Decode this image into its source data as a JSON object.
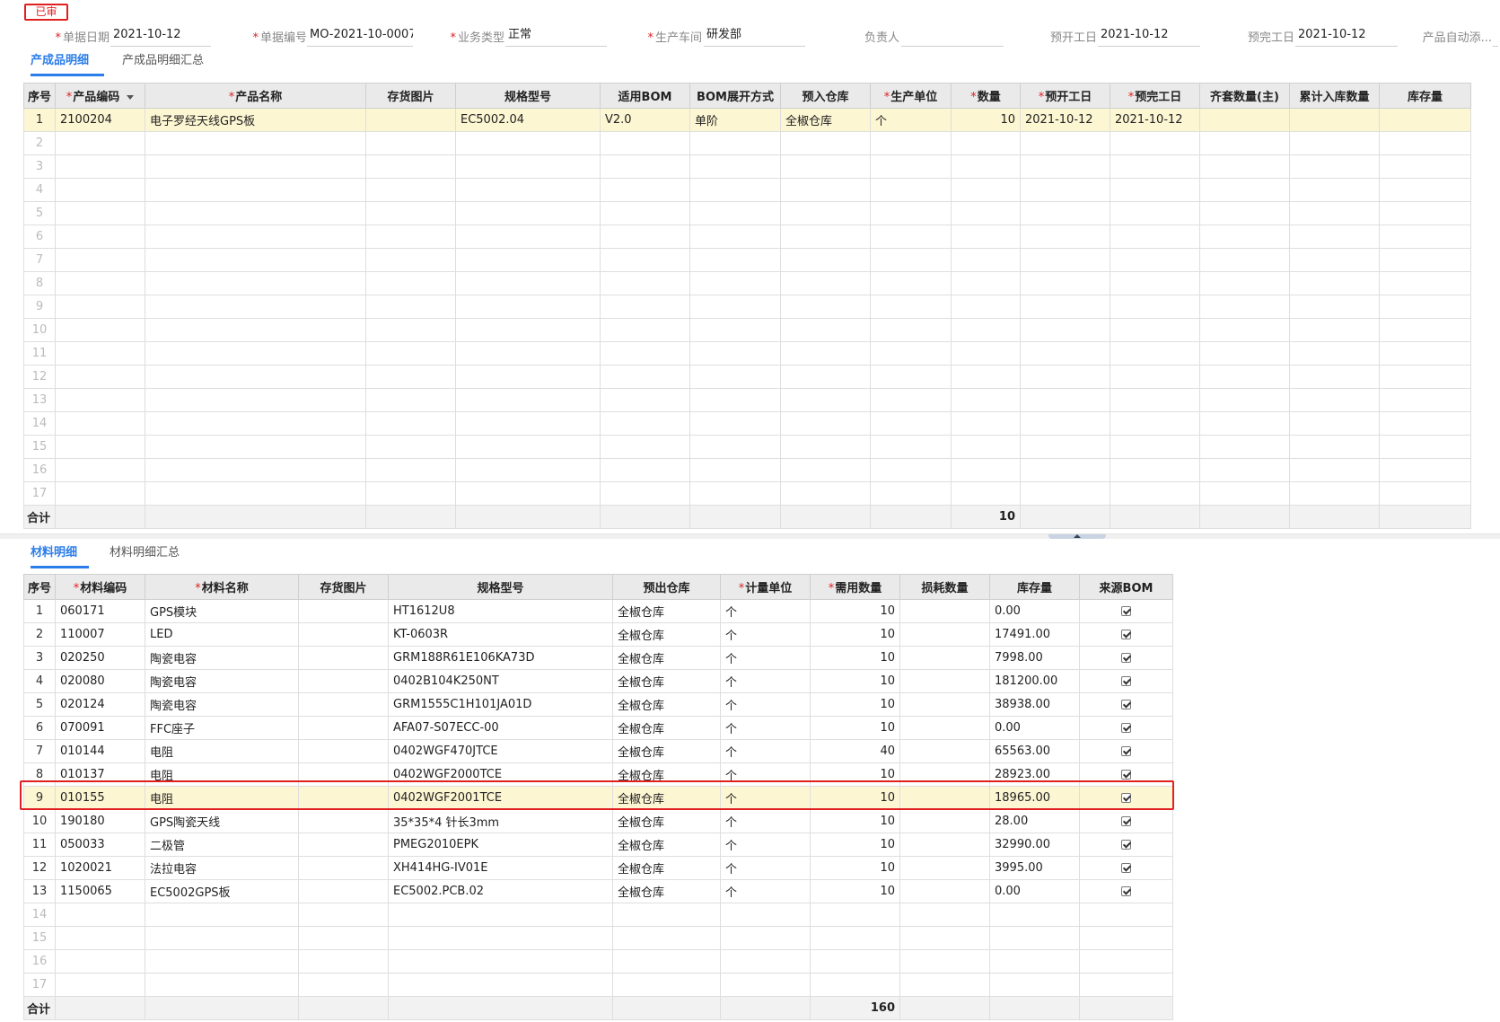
{
  "status_badge": "已审",
  "header": {
    "fields": [
      {
        "label": "单据日期",
        "required": true,
        "value": "2021-10-12"
      },
      {
        "label": "单据编号",
        "required": true,
        "value": "MO-2021-10-0007"
      },
      {
        "label": "业务类型",
        "required": true,
        "value": "正常"
      },
      {
        "label": "生产车间",
        "required": true,
        "value": "研发部"
      },
      {
        "label": "负责人",
        "required": false,
        "value": ""
      },
      {
        "label": "预开工日",
        "required": false,
        "value": "2021-10-12"
      },
      {
        "label": "预完工日",
        "required": false,
        "value": "2021-10-12"
      },
      {
        "label": "产品自动添...",
        "required": false,
        "value": ""
      }
    ]
  },
  "product_tabs": [
    "产成品明细",
    "产成品明细汇总"
  ],
  "product_table": {
    "columns": [
      {
        "label": "序号",
        "required": false
      },
      {
        "label": "产品编码",
        "required": true
      },
      {
        "label": "产品名称",
        "required": true
      },
      {
        "label": "存货图片",
        "required": false
      },
      {
        "label": "规格型号",
        "required": false
      },
      {
        "label": "适用BOM",
        "required": false
      },
      {
        "label": "BOM展开方式",
        "required": false
      },
      {
        "label": "预入仓库",
        "required": false
      },
      {
        "label": "生产单位",
        "required": true
      },
      {
        "label": "数量",
        "required": true
      },
      {
        "label": "预开工日",
        "required": true
      },
      {
        "label": "预完工日",
        "required": true
      },
      {
        "label": "齐套数量(主)",
        "required": false
      },
      {
        "label": "累计入库数量",
        "required": false
      },
      {
        "label": "库存量",
        "required": false
      }
    ],
    "rows": [
      [
        "1",
        "2100204",
        "电子罗经天线GPS板",
        "",
        "EC5002.04",
        "V2.0",
        "单阶",
        "全椒仓库",
        "个",
        "10",
        "2021-10-12",
        "2021-10-12",
        "",
        "",
        ""
      ]
    ],
    "row_count": 17,
    "total_label": "合计",
    "total_qty": "10"
  },
  "material_tabs": [
    "材料明细",
    "材料明细汇总"
  ],
  "material_table": {
    "columns": [
      {
        "label": "序号",
        "required": false
      },
      {
        "label": "材料编码",
        "required": true
      },
      {
        "label": "材料名称",
        "required": true
      },
      {
        "label": "存货图片",
        "required": false
      },
      {
        "label": "规格型号",
        "required": false
      },
      {
        "label": "预出仓库",
        "required": false
      },
      {
        "label": "计量单位",
        "required": true
      },
      {
        "label": "需用数量",
        "required": true
      },
      {
        "label": "损耗数量",
        "required": false
      },
      {
        "label": "库存量",
        "required": false
      },
      {
        "label": "来源BOM",
        "required": false
      }
    ],
    "rows": [
      [
        "1",
        "060171",
        "GPS模块",
        "",
        "HT1612U8",
        "全椒仓库",
        "个",
        "10",
        "",
        "0.00",
        true
      ],
      [
        "2",
        "110007",
        "LED",
        "",
        "KT-0603R",
        "全椒仓库",
        "个",
        "10",
        "",
        "17491.00",
        true
      ],
      [
        "3",
        "020250",
        "陶瓷电容",
        "",
        "GRM188R61E106KA73D",
        "全椒仓库",
        "个",
        "10",
        "",
        "7998.00",
        true
      ],
      [
        "4",
        "020080",
        "陶瓷电容",
        "",
        "0402B104K250NT",
        "全椒仓库",
        "个",
        "10",
        "",
        "181200.00",
        true
      ],
      [
        "5",
        "020124",
        "陶瓷电容",
        "",
        "GRM1555C1H101JA01D",
        "全椒仓库",
        "个",
        "10",
        "",
        "38938.00",
        true
      ],
      [
        "6",
        "070091",
        "FFC座子",
        "",
        "AFA07-S07ECC-00",
        "全椒仓库",
        "个",
        "10",
        "",
        "0.00",
        true
      ],
      [
        "7",
        "010144",
        "电阻",
        "",
        "0402WGF470JTCE",
        "全椒仓库",
        "个",
        "40",
        "",
        "65563.00",
        true
      ],
      [
        "8",
        "010137",
        "电阻",
        "",
        "0402WGF2000TCE",
        "全椒仓库",
        "个",
        "10",
        "",
        "28923.00",
        true
      ],
      [
        "9",
        "010155",
        "电阻",
        "",
        "0402WGF2001TCE",
        "全椒仓库",
        "个",
        "10",
        "",
        "18965.00",
        true
      ],
      [
        "10",
        "190180",
        "GPS陶瓷天线",
        "",
        "35*35*4 针长3mm",
        "全椒仓库",
        "个",
        "10",
        "",
        "28.00",
        true
      ],
      [
        "11",
        "050033",
        "二极管",
        "",
        "PMEG2010EPK",
        "全椒仓库",
        "个",
        "10",
        "",
        "32990.00",
        true
      ],
      [
        "12",
        "1020021",
        "法拉电容",
        "",
        "XH414HG-IV01E",
        "全椒仓库",
        "个",
        "10",
        "",
        "3995.00",
        true
      ],
      [
        "13",
        "1150065",
        "EC5002GPS板",
        "",
        "EC5002.PCB.02",
        "全椒仓库",
        "个",
        "10",
        "",
        "0.00",
        true
      ]
    ],
    "row_count": 17,
    "selected_row": 9,
    "total_label": "合计",
    "total_qty": "160"
  }
}
